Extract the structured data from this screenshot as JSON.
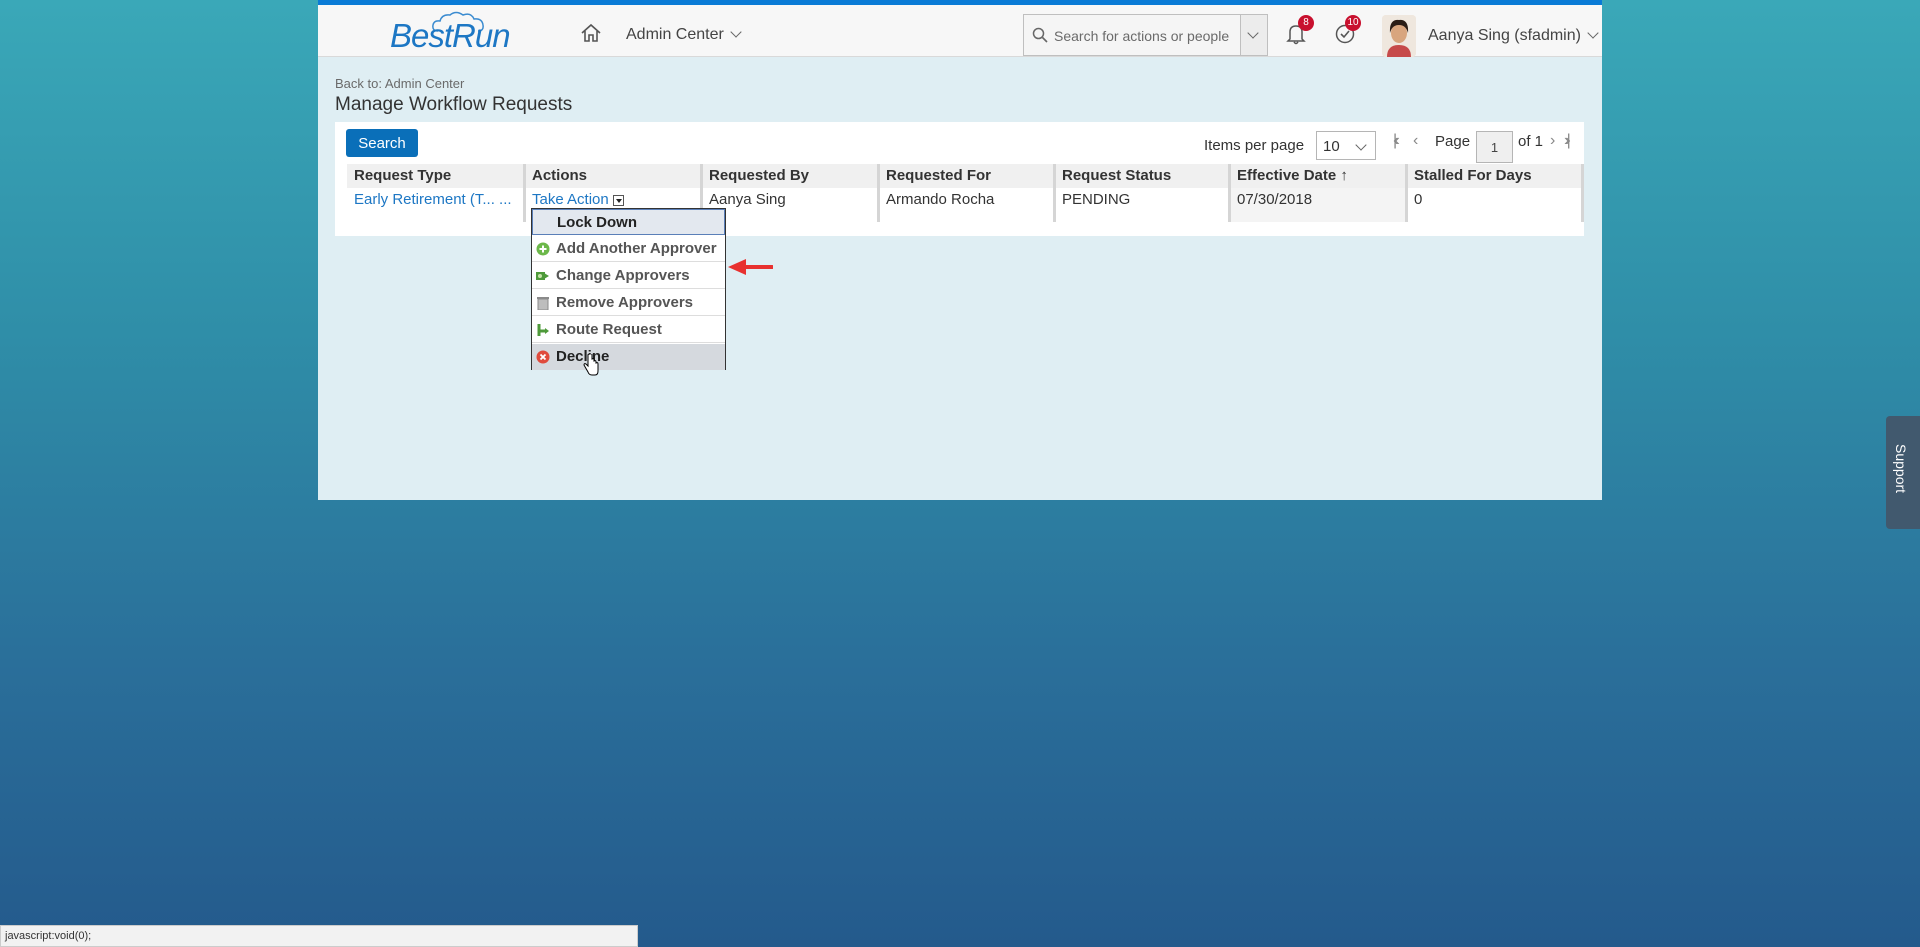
{
  "header": {
    "logo_text": "BestRun",
    "nav_label": "Admin Center",
    "search_placeholder": "Search for actions or people",
    "notifications_count": "8",
    "tasks_count": "10",
    "user_name": "Aanya Sing (sfadmin)"
  },
  "page": {
    "back_link": "Back to: Admin Center",
    "title": "Manage Workflow Requests",
    "search_button": "Search",
    "items_per_page_label": "Items per page",
    "items_per_page_value": "10",
    "page_label": "Page",
    "page_value": "1",
    "page_of": "of 1"
  },
  "table": {
    "headers": [
      "Request Type",
      "Actions",
      "Requested By",
      "Requested For",
      "Request Status",
      "Effective Date",
      "Stalled For Days"
    ],
    "sort_indicator": "↑",
    "row": {
      "request_type": "Early Retirement (T... ...",
      "action": "Take Action",
      "requested_by": "Aanya Sing",
      "requested_for": "Armando Rocha",
      "status": "PENDING",
      "effective_date": "07/30/2018",
      "stalled_days": "0"
    }
  },
  "menu": {
    "items": [
      "Lock Down",
      "Add Another Approver",
      "Change Approvers",
      "Remove Approvers",
      "Route Request",
      "Decline"
    ]
  },
  "status_bar": "javascript:void(0);",
  "support_label": "Support",
  "colors": {
    "accent": "#0a6fb9",
    "badge": "#c8102e",
    "arrow": "#e8312f"
  }
}
